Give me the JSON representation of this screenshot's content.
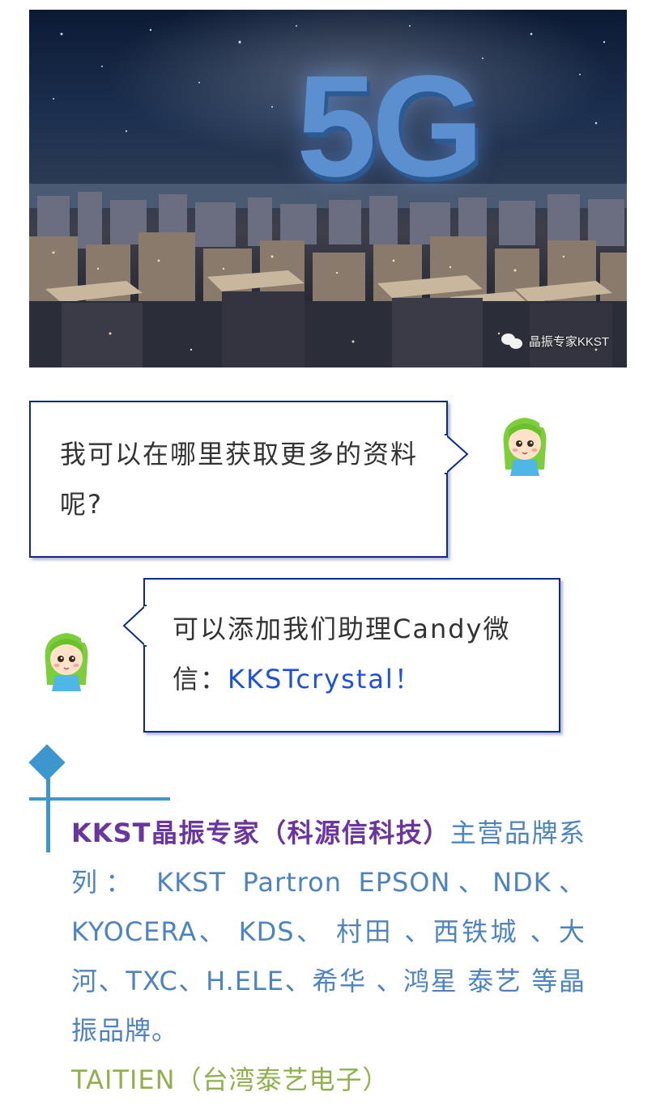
{
  "hero": {
    "headline": "5G",
    "watermark": "晶振专家KKST",
    "watermark_icon": "wechat-icon"
  },
  "chat": {
    "question": "我可以在哪里获取更多的资料呢?",
    "answer_prefix": "可以添加我们助理Candy微信：",
    "answer_wechat_id": "KKSTcrystal！",
    "avatar_icon": "cartoon-girl-avatar"
  },
  "brands": {
    "company": "KKST晶振专家（科源信科技）",
    "series": "主营品牌系列： KKST Partron EPSON、NDK、KYOCERA、 KDS、 村田 、西铁城 、大河、TXC、H.ELE、希华 、鸿星 泰艺 等晶振品牌。",
    "taitien": "TAITIEN（台湾泰艺电子）"
  },
  "colors": {
    "bubble_border": "#0d2a8c",
    "link": "#1d4fe0",
    "accent": "#3c97cf",
    "company": "#6b35a0",
    "brand_text": "#4e83c2",
    "taitien": "#8fb04c"
  }
}
